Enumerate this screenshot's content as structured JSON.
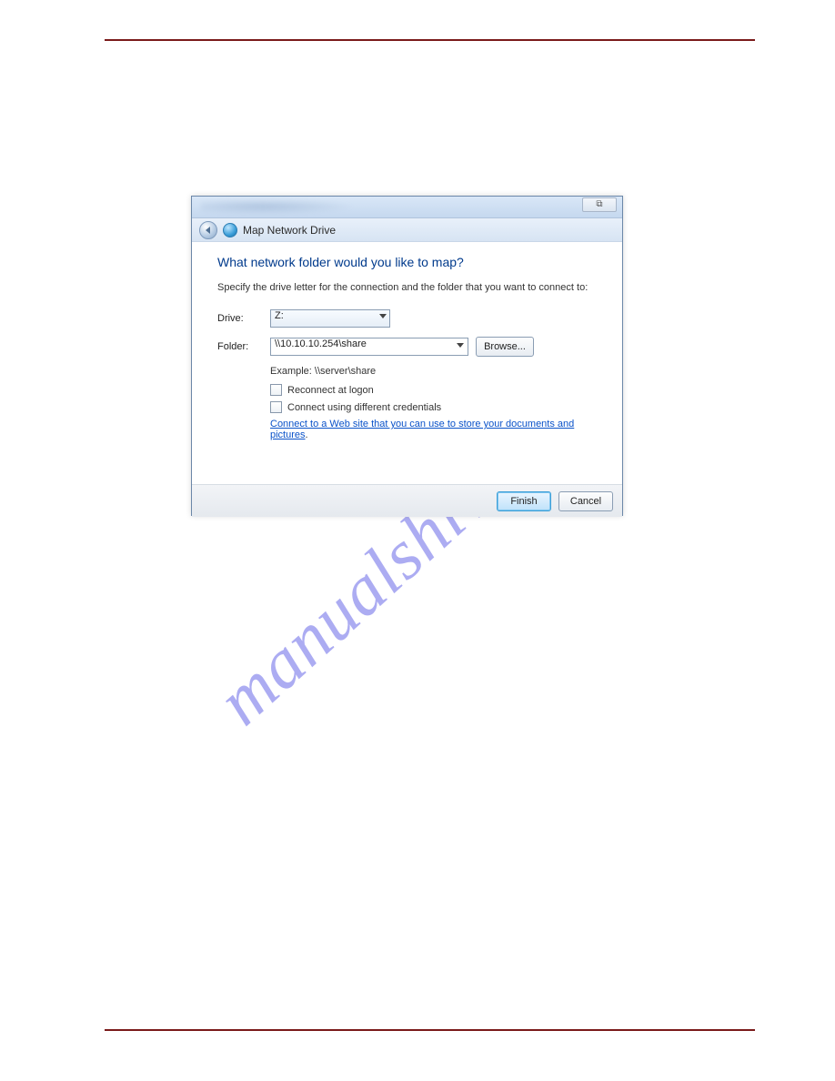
{
  "watermark": "manualshive.com",
  "dialog": {
    "close_glyph": "⧉",
    "title": "Map Network Drive",
    "heading": "What network folder would you like to map?",
    "instruction": "Specify the drive letter for the connection and the folder that you want to connect to:",
    "drive_label": "Drive:",
    "drive_value": "Z:",
    "folder_label": "Folder:",
    "folder_value": "\\\\10.10.10.254\\share",
    "browse_label": "Browse...",
    "example_text": "Example: \\\\server\\share",
    "reconnect_label": "Reconnect at logon",
    "diffcreds_label": "Connect using different credentials",
    "link_text": "Connect to a Web site that you can use to store your documents and pictures",
    "link_suffix": ".",
    "finish_label": "Finish",
    "cancel_label": "Cancel"
  }
}
